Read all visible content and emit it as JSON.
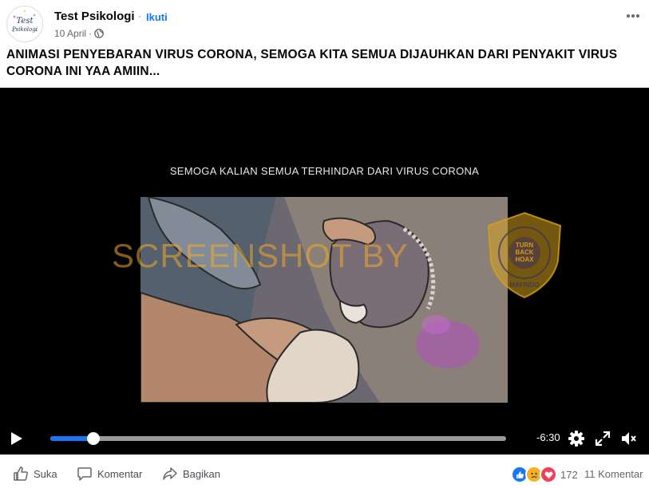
{
  "post": {
    "page_name": "Test Psikologi",
    "dot": "·",
    "follow_label": "Ikuti",
    "date": "10 April",
    "separator": "·",
    "privacy_icon": "globe-icon",
    "avatar_text_1": "Test",
    "avatar_text_2": "Psikologi",
    "caption": "ANIMASI PENYEBARAN VIRUS CORONA, SEMOGA KITA SEMUA DIJAUHKAN DARI PENYAKIT VIRUS CORONA INI YAA AMIIN..."
  },
  "video": {
    "subtitle": "SEMOGA KALIAN SEMUA TERHINDAR DARI VIRUS CORONA",
    "watermark": "SCREENSHOT BY",
    "seal_center": [
      "TURN",
      "BACK",
      "HOAX"
    ],
    "seal_bottom": "MAFINDO",
    "seal_ring": "MASYARAKAT ANTI FITNAH INDONESIA",
    "time_remaining": "-6:30",
    "progress": 0.095,
    "accent_color": "#1877f2"
  },
  "footer": {
    "like_label": "Suka",
    "comment_label": "Komentar",
    "share_label": "Bagikan",
    "reaction_count": "172",
    "comment_count": "11 Komentar"
  }
}
